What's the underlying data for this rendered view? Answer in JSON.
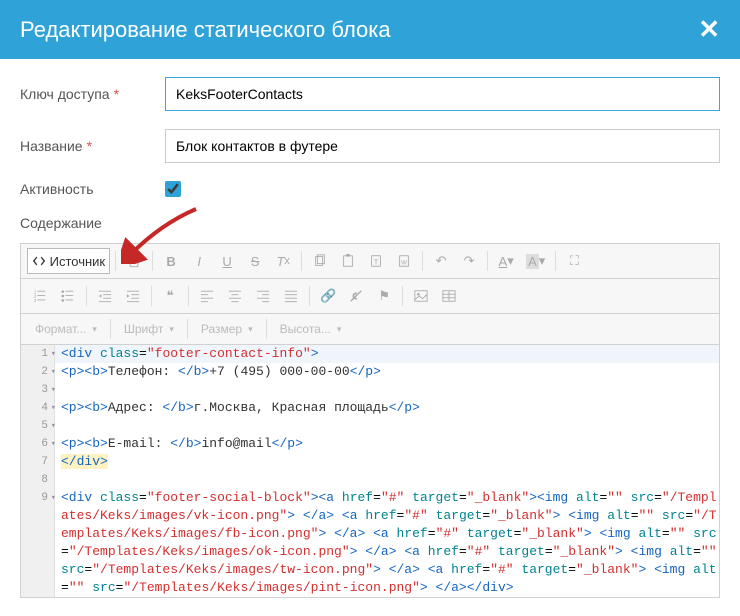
{
  "header": {
    "title": "Редактирование статического блока"
  },
  "form": {
    "accessKey": {
      "label": "Ключ доступа",
      "value": "KeksFooterContacts"
    },
    "name": {
      "label": "Название",
      "value": "Блок контактов в футере"
    },
    "active": {
      "label": "Активность",
      "checked": true
    },
    "content": {
      "label": "Содержание"
    }
  },
  "toolbar": {
    "source": "Источник",
    "format": "Формат...",
    "font": "Шрифт",
    "size": "Размер",
    "height": "Высота..."
  },
  "code": {
    "lines": [
      {
        "n": 1,
        "fold": true,
        "hl": true,
        "html": "<span class='tag'>&lt;div</span> <span class='attr'>class</span>=<span class='val'>\"footer-contact-info\"</span><span class='tag'>&gt;</span>"
      },
      {
        "n": 2,
        "fold": true,
        "html": "<span class='tag'>&lt;p&gt;&lt;b&gt;</span><span class='txt'>Телефон: </span><span class='tag'>&lt;/b&gt;</span><span class='txt'>+7 (495) 000-00-00</span><span class='tag'>&lt;/p&gt;</span>"
      },
      {
        "n": 3,
        "fold": true,
        "html": ""
      },
      {
        "n": 4,
        "fold": true,
        "html": "<span class='tag'>&lt;p&gt;&lt;b&gt;</span><span class='txt'>Адрес: </span><span class='tag'>&lt;/b&gt;</span><span class='txt'>г.Москва, Красная площадь</span><span class='tag'>&lt;/p&gt;</span>"
      },
      {
        "n": 5,
        "fold": true,
        "html": ""
      },
      {
        "n": 6,
        "fold": true,
        "html": "<span class='tag'>&lt;p&gt;&lt;b&gt;</span><span class='txt'>E-mail: </span><span class='tag'>&lt;/b&gt;</span><span class='txt'>info@mail</span><span class='tag'>&lt;/p&gt;</span>"
      },
      {
        "n": 7,
        "html": "<span class='tag endtag'>&lt;/div&gt;</span>"
      },
      {
        "n": 8,
        "html": ""
      },
      {
        "n": 9,
        "fold": true,
        "html": "<span class='tag'>&lt;div</span> <span class='attr'>class</span>=<span class='val'>\"footer-social-block\"</span><span class='tag'>&gt;&lt;a</span> <span class='attr'>href</span>=<span class='val'>\"#\"</span> <span class='attr'>target</span>=<span class='val'>\"_blank\"</span><span class='tag'>&gt;&lt;img</span> <span class='attr'>alt</span>=<span class='val'>\"\"</span> <span class='attr'>src</span>=<span class='val'>\"/Templates/Keks/images/vk-icon.png\"</span><span class='tag'>&gt;</span> <span class='tag'>&lt;/a&gt;</span> <span class='tag'>&lt;a</span> <span class='attr'>href</span>=<span class='val'>\"#\"</span> <span class='attr'>target</span>=<span class='val'>\"_blank\"</span><span class='tag'>&gt;</span> <span class='tag'>&lt;img</span> <span class='attr'>alt</span>=<span class='val'>\"\"</span> <span class='attr'>src</span>=<span class='val'>\"/Templates/Keks/images/fb-icon.png\"</span><span class='tag'>&gt;</span> <span class='tag'>&lt;/a&gt;</span> <span class='tag'>&lt;a</span> <span class='attr'>href</span>=<span class='val'>\"#\"</span> <span class='attr'>target</span>=<span class='val'>\"_blank\"</span><span class='tag'>&gt;</span> <span class='tag'>&lt;img</span> <span class='attr'>alt</span>=<span class='val'>\"\"</span> <span class='attr'>src</span>=<span class='val'>\"/Templates/Keks/images/ok-icon.png\"</span><span class='tag'>&gt;</span> <span class='tag'>&lt;/a&gt;</span> <span class='tag'>&lt;a</span> <span class='attr'>href</span>=<span class='val'>\"#\"</span> <span class='attr'>target</span>=<span class='val'>\"_blank\"</span><span class='tag'>&gt;</span> <span class='tag'>&lt;img</span> <span class='attr'>alt</span>=<span class='val'>\"\"</span> <span class='attr'>src</span>=<span class='val'>\"/Templates/Keks/images/tw-icon.png\"</span><span class='tag'>&gt;</span> <span class='tag'>&lt;/a&gt;</span> <span class='tag'>&lt;a</span> <span class='attr'>href</span>=<span class='val'>\"#\"</span> <span class='attr'>target</span>=<span class='val'>\"_blank\"</span><span class='tag'>&gt;</span> <span class='tag'>&lt;img</span> <span class='attr'>alt</span>=<span class='val'>\"\"</span> <span class='attr'>src</span>=<span class='val'>\"/Templates/Keks/images/pint-icon.png\"</span><span class='tag'>&gt;</span> <span class='tag'>&lt;/a&gt;&lt;/div&gt;</span>"
      }
    ]
  }
}
